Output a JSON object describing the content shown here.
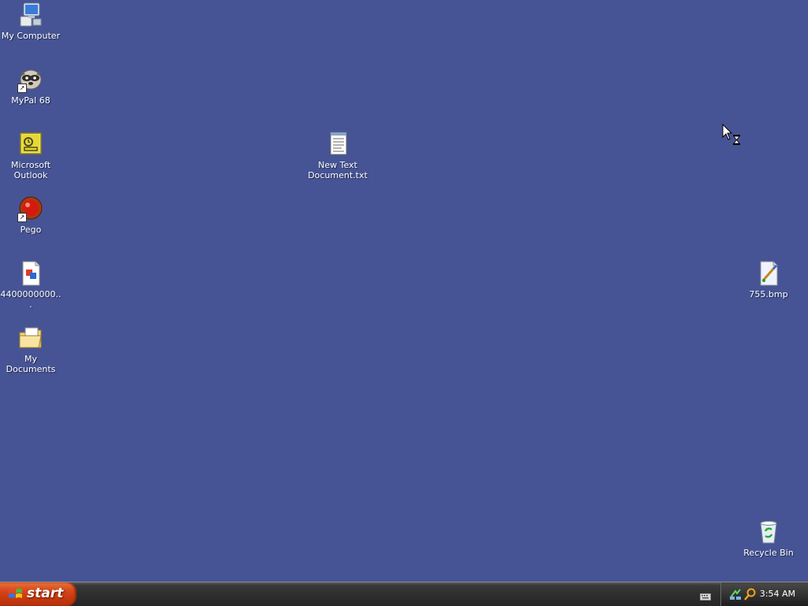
{
  "desktop": {
    "background_color": "#465495",
    "icons": [
      {
        "label": "My Computer",
        "icon": "my-computer-icon"
      },
      {
        "label": "MyPal 68",
        "icon": "mypal-raccoon-icon"
      },
      {
        "label": "Microsoft\nOutlook",
        "icon": "outlook-icon"
      },
      {
        "label": "Pego",
        "icon": "pego-red-ball-icon"
      },
      {
        "label": "4400000000...",
        "icon": "image-file-icon"
      },
      {
        "label": "My Documents",
        "icon": "my-documents-folder-icon"
      },
      {
        "label": "New Text\nDocument.txt",
        "icon": "text-document-icon"
      },
      {
        "label": "755.bmp",
        "icon": "bitmap-paint-icon"
      },
      {
        "label": "Recycle Bin",
        "icon": "recycle-bin-icon"
      }
    ]
  },
  "taskbar": {
    "start_label": "start",
    "start_icon": "windows-flag-icon",
    "tray": {
      "clock": "3:54 AM",
      "icons": [
        "network-icon",
        "search-icon"
      ],
      "keyboard_icon": "keyboard-icon"
    }
  },
  "cursor": "busy-arrow-hourglass-cursor"
}
